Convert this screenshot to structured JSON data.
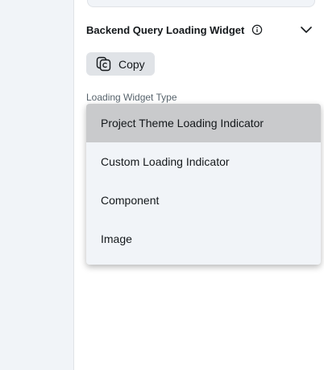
{
  "section": {
    "title": "Backend Query Loading Widget"
  },
  "copy_button": {
    "label": "Copy"
  },
  "field": {
    "label": "Loading Widget Type"
  },
  "dropdown": {
    "selected": "Project Theme Loading Indicator",
    "options": [
      "Project Theme Loading Indicator",
      "Custom Loading Indicator",
      "Component",
      "Image"
    ]
  },
  "icons": {
    "info": "info-icon",
    "expand": "chevron-down-icon",
    "copy": "copy-icon"
  },
  "colors": {
    "panel_bg": "#ffffff",
    "sidebar_bg": "#f1f4f8",
    "button_bg": "#e0e3e7",
    "selected_option_bg": "#c9cacc",
    "text_primary": "#14181b",
    "text_secondary": "#57636c"
  }
}
